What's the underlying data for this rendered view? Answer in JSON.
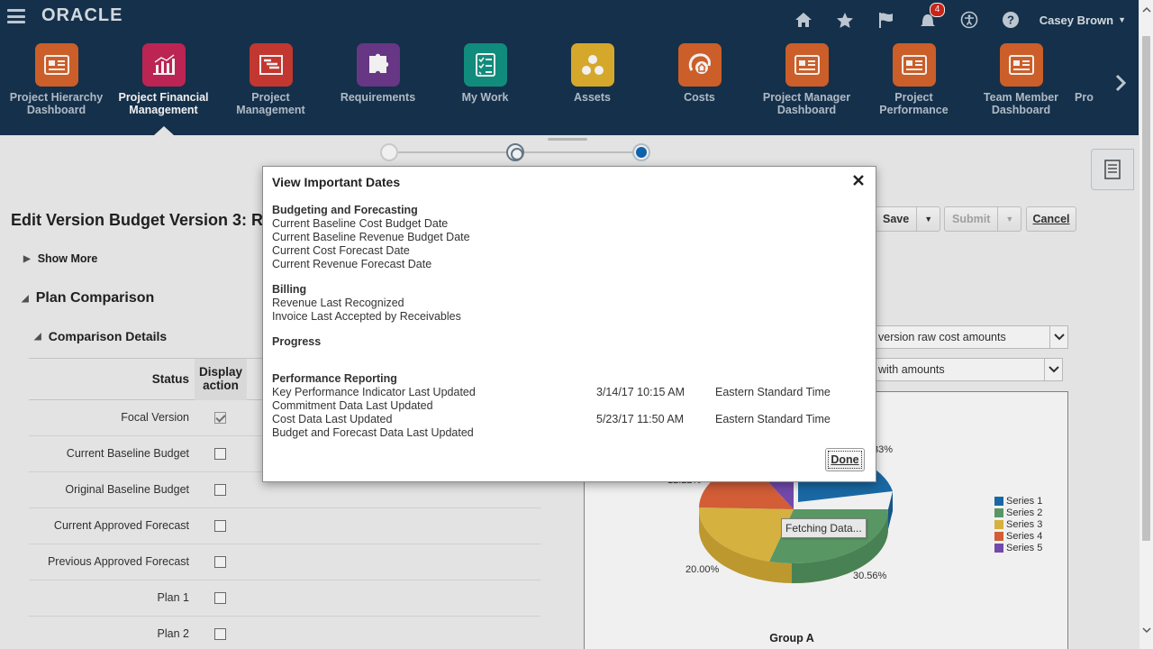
{
  "header": {
    "brand": "ORACLE",
    "user_name": "Casey Brown",
    "notification_count": "4",
    "icons": [
      "home-icon",
      "star-icon",
      "flag-icon",
      "notifications-icon",
      "accessibility-icon",
      "help-icon"
    ]
  },
  "springboard": {
    "items": [
      {
        "label": "Project Hierarchy Dashboard",
        "icon": "dashboard-icon",
        "color": "#d8642c",
        "active": false
      },
      {
        "label": "Project Financial Management",
        "icon": "bar-chart-icon",
        "color": "#c8275a",
        "active": true
      },
      {
        "label": "Project Management",
        "icon": "gantt-icon",
        "color": "#cf3b33",
        "active": false
      },
      {
        "label": "Requirements",
        "icon": "puzzle-icon",
        "color": "#6e3a8e",
        "active": false
      },
      {
        "label": "My Work",
        "icon": "checklist-icon",
        "color": "#139584",
        "active": false
      },
      {
        "label": "Assets",
        "icon": "assets-icon",
        "color": "#e3b32e",
        "active": false
      },
      {
        "label": "Costs",
        "icon": "costs-icon",
        "color": "#d8642c",
        "active": false
      },
      {
        "label": "Project Manager Dashboard",
        "icon": "dashboard-icon",
        "color": "#d8642c",
        "active": false
      },
      {
        "label": "Project Performance",
        "icon": "dashboard-icon",
        "color": "#d8642c",
        "active": false
      },
      {
        "label": "Team Member Dashboard",
        "icon": "dashboard-icon",
        "color": "#d8642c",
        "active": false
      },
      {
        "label": "Pro",
        "icon": "",
        "color": "",
        "active": false
      }
    ]
  },
  "page": {
    "title": "Edit Version Budget Version 3: R",
    "show_more": "Show More",
    "plan_comparison": "Plan Comparison",
    "comparison_details": "Comparison Details",
    "buttons": {
      "save": "Save",
      "submit": "Submit",
      "cancel": "Cancel"
    }
  },
  "comparison_table": {
    "headers": {
      "status": "Status",
      "display_action": "Display action"
    },
    "rows": [
      {
        "status": "Focal Version",
        "checked": true
      },
      {
        "status": "Current Baseline Budget",
        "checked": false
      },
      {
        "status": "Original Baseline Budget",
        "checked": false
      },
      {
        "status": "Current Approved Forecast",
        "checked": false
      },
      {
        "status": "Previous Approved Forecast",
        "checked": false
      },
      {
        "status": "Plan 1",
        "checked": false
      },
      {
        "status": "Plan 2",
        "checked": false
      }
    ]
  },
  "selects": {
    "first": "version raw cost amounts",
    "second": "with amounts"
  },
  "chart_data": {
    "type": "pie",
    "visible_labels": [
      "33%",
      "12.22%",
      "20.00%",
      "30.56%"
    ],
    "slices": [
      {
        "name": "Series 1",
        "color": "#1b6fae"
      },
      {
        "name": "Series 2",
        "color": "#5ea16b"
      },
      {
        "name": "Series 3",
        "color": "#e3bd43"
      },
      {
        "name": "Series 4",
        "color": "#e0633b"
      },
      {
        "name": "Series 5",
        "color": "#7a4eb6"
      }
    ],
    "group_label": "Group A",
    "loading_text": "Fetching Data...",
    "legend_position": "right"
  },
  "dialog": {
    "title": "View Important Dates",
    "sections": [
      {
        "title": "Budgeting and Forecasting",
        "rows": [
          {
            "label": "Current Baseline Cost Budget Date",
            "date": "",
            "tz": ""
          },
          {
            "label": "Current Baseline Revenue Budget Date",
            "date": "",
            "tz": ""
          },
          {
            "label": "Current Cost Forecast Date",
            "date": "",
            "tz": ""
          },
          {
            "label": "Current Revenue Forecast Date",
            "date": "",
            "tz": ""
          }
        ]
      },
      {
        "title": "Billing",
        "rows": [
          {
            "label": "Revenue Last Recognized",
            "date": "",
            "tz": ""
          },
          {
            "label": "Invoice Last Accepted by Receivables",
            "date": "",
            "tz": ""
          }
        ]
      },
      {
        "title": "Progress",
        "rows": []
      },
      {
        "title": "Performance Reporting",
        "rows": [
          {
            "label": "Key Performance Indicator Last Updated",
            "date": "3/14/17 10:15 AM",
            "tz": "Eastern Standard Time"
          },
          {
            "label": "Commitment Data Last Updated",
            "date": "",
            "tz": ""
          },
          {
            "label": "Cost Data Last Updated",
            "date": "5/23/17 11:50 AM",
            "tz": "Eastern Standard Time"
          },
          {
            "label": "Budget and Forecast Data Last Updated",
            "date": "",
            "tz": ""
          }
        ]
      }
    ],
    "done_label": "Done"
  }
}
